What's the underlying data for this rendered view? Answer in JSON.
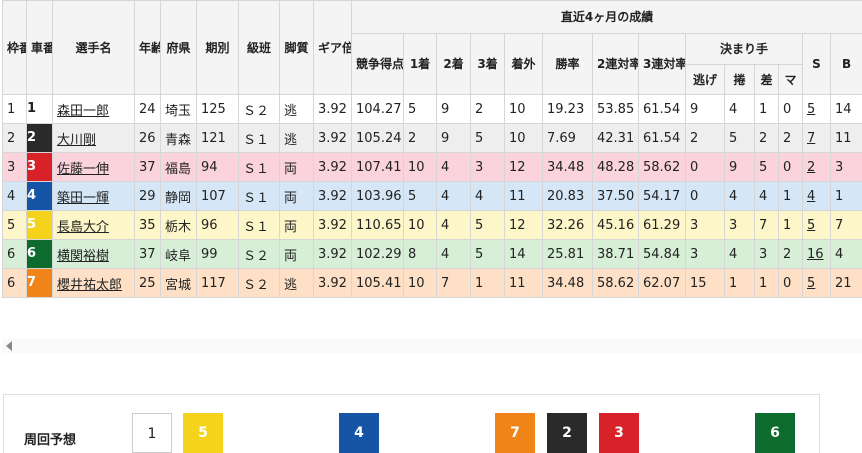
{
  "header": {
    "waku": "枠番",
    "car": "車番",
    "name": "選手名",
    "age": "年齢",
    "pref": "府県",
    "term": "期別",
    "rank": "級班",
    "style": "脚質",
    "gear": "ギア倍率",
    "recent": "直近4ヶ月の成績",
    "score": "競争得点",
    "first": "1着",
    "second": "2着",
    "third": "3着",
    "out": "着外",
    "win_rate": "勝率",
    "rate2": "2連対率",
    "rate3": "3連対率",
    "kimarite": "決まり手",
    "nige": "逃げ",
    "makuri": "捲",
    "sashi": "差",
    "ma": "マ",
    "s": "S",
    "b": "B"
  },
  "racers": [
    {
      "waku": "1",
      "car": "1",
      "color": "c1",
      "name": "森田一郎",
      "age": "24",
      "pref": "埼玉",
      "term": "125",
      "rank": "Ｓ２",
      "style": "逃",
      "gear": "3.92",
      "score": "104.27",
      "first": "5",
      "second": "9",
      "third": "2",
      "out": "10",
      "win_rate": "19.23",
      "rate2": "53.85",
      "rate3": "61.54",
      "nige": "9",
      "makuri": "4",
      "sashi": "1",
      "ma": "0",
      "s": "5",
      "b": "14"
    },
    {
      "waku": "2",
      "car": "2",
      "color": "c2",
      "name": "大川剛",
      "age": "26",
      "pref": "青森",
      "term": "121",
      "rank": "Ｓ１",
      "style": "逃",
      "gear": "3.92",
      "score": "105.24",
      "first": "2",
      "second": "9",
      "third": "5",
      "out": "10",
      "win_rate": "7.69",
      "rate2": "42.31",
      "rate3": "61.54",
      "nige": "2",
      "makuri": "5",
      "sashi": "2",
      "ma": "2",
      "s": "7",
      "b": "11"
    },
    {
      "waku": "3",
      "car": "3",
      "color": "c3",
      "name": "佐藤一伸",
      "age": "37",
      "pref": "福島",
      "term": "94",
      "rank": "Ｓ１",
      "style": "両",
      "gear": "3.92",
      "score": "107.41",
      "first": "10",
      "second": "4",
      "third": "3",
      "out": "12",
      "win_rate": "34.48",
      "rate2": "48.28",
      "rate3": "58.62",
      "nige": "0",
      "makuri": "9",
      "sashi": "5",
      "ma": "0",
      "s": "2",
      "b": "3"
    },
    {
      "waku": "4",
      "car": "4",
      "color": "c4",
      "name": "築田一輝",
      "age": "29",
      "pref": "静岡",
      "term": "107",
      "rank": "Ｓ１",
      "style": "両",
      "gear": "3.92",
      "score": "103.96",
      "first": "5",
      "second": "4",
      "third": "4",
      "out": "11",
      "win_rate": "20.83",
      "rate2": "37.50",
      "rate3": "54.17",
      "nige": "0",
      "makuri": "4",
      "sashi": "4",
      "ma": "1",
      "s": "4",
      "b": "1"
    },
    {
      "waku": "5",
      "car": "5",
      "color": "c5",
      "name": "長島大介",
      "age": "35",
      "pref": "栃木",
      "term": "96",
      "rank": "Ｓ１",
      "style": "両",
      "gear": "3.92",
      "score": "110.65",
      "first": "10",
      "second": "4",
      "third": "5",
      "out": "12",
      "win_rate": "32.26",
      "rate2": "45.16",
      "rate3": "61.29",
      "nige": "3",
      "makuri": "3",
      "sashi": "7",
      "ma": "1",
      "s": "5",
      "b": "7"
    },
    {
      "waku": "6",
      "car": "6",
      "color": "c6",
      "name": "横関裕樹",
      "age": "37",
      "pref": "岐阜",
      "term": "99",
      "rank": "Ｓ２",
      "style": "両",
      "gear": "3.92",
      "score": "102.29",
      "first": "8",
      "second": "4",
      "third": "5",
      "out": "14",
      "win_rate": "25.81",
      "rate2": "38.71",
      "rate3": "54.84",
      "nige": "3",
      "makuri": "4",
      "sashi": "3",
      "ma": "2",
      "s": "16",
      "b": "4"
    },
    {
      "waku": "6",
      "car": "7",
      "color": "c7",
      "name": "櫻井祐太郎",
      "age": "25",
      "pref": "宮城",
      "term": "117",
      "rank": "Ｓ２",
      "style": "逃",
      "gear": "3.92",
      "score": "105.41",
      "first": "10",
      "second": "7",
      "third": "1",
      "out": "11",
      "win_rate": "34.48",
      "rate2": "58.62",
      "rate3": "62.07",
      "nige": "15",
      "makuri": "1",
      "sashi": "1",
      "ma": "0",
      "s": "5",
      "b": "21"
    }
  ],
  "forecast": {
    "label": "周回予想",
    "cars": [
      {
        "car": "1",
        "color": "c1"
      },
      {
        "car": "5",
        "color": "c5"
      },
      {
        "car": "4",
        "color": "c4"
      },
      {
        "car": "7",
        "color": "c7"
      },
      {
        "car": "2",
        "color": "c2"
      },
      {
        "car": "3",
        "color": "c3"
      },
      {
        "car": "6",
        "color": "c6"
      }
    ]
  }
}
